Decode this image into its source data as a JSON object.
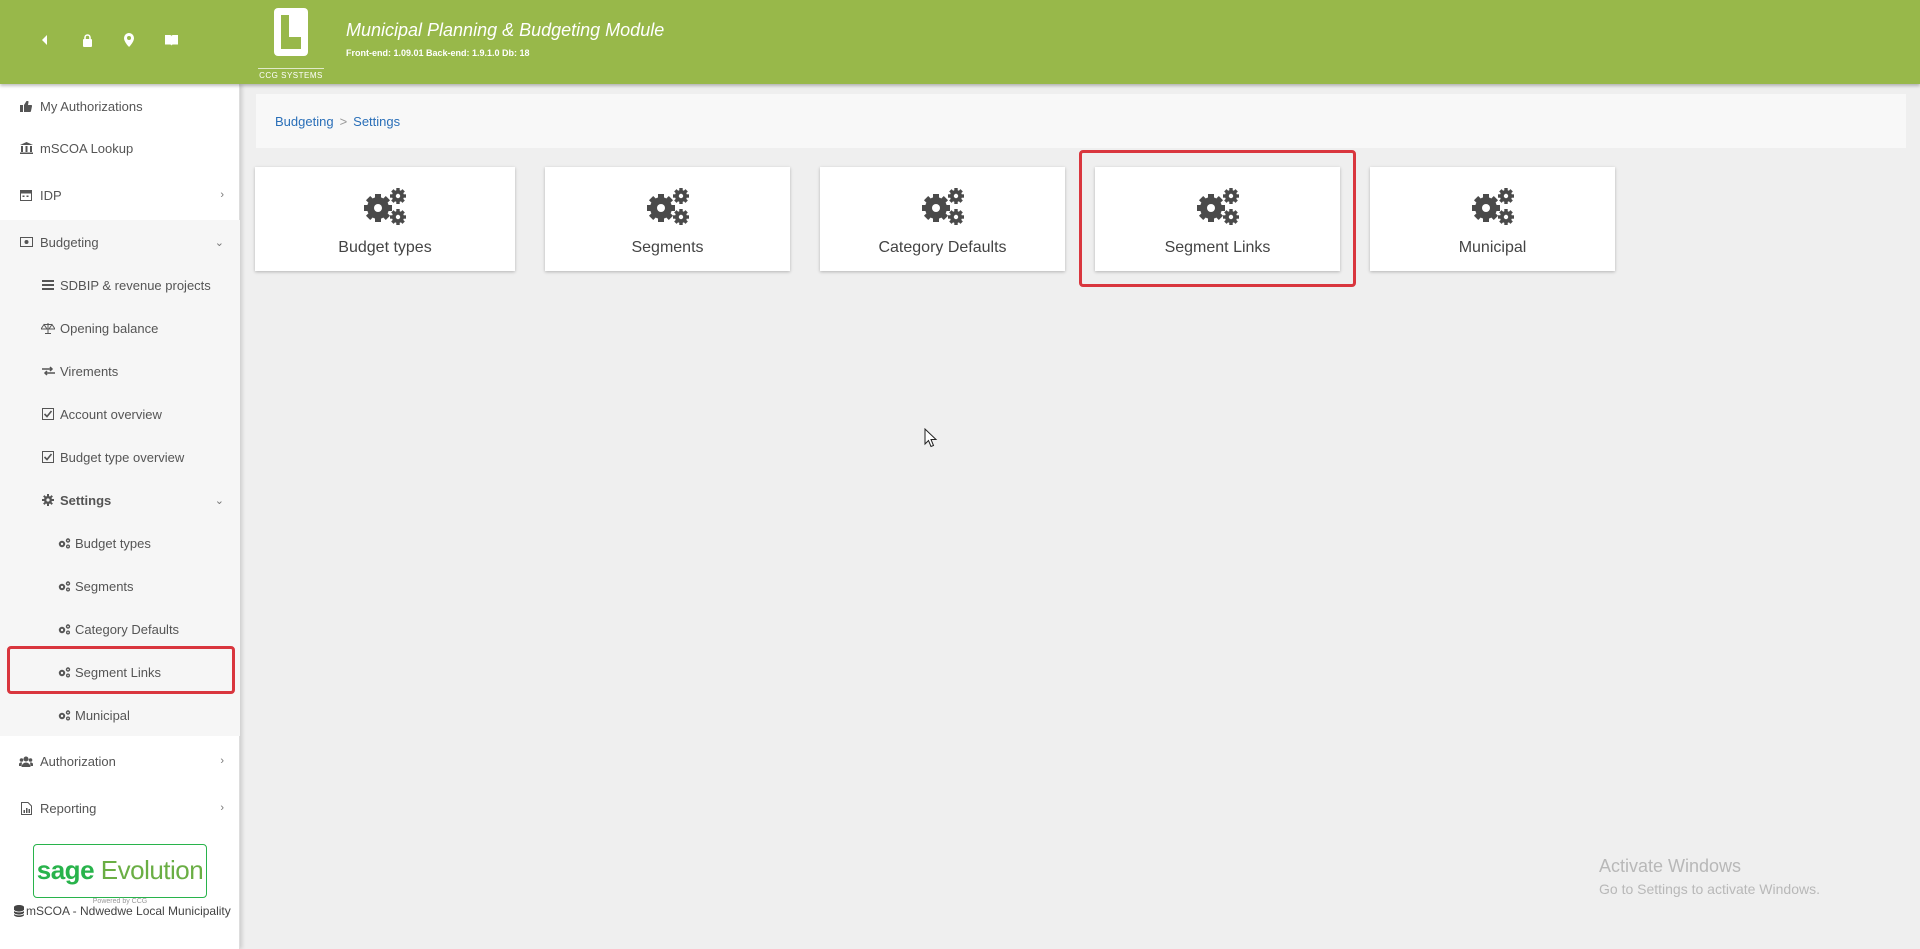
{
  "header": {
    "title": "Municipal Planning & Budgeting Module",
    "version": "Front-end: 1.09.01 Back-end: 1.9.1.0 Db: 18",
    "logo_caption": "CCG SYSTEMS",
    "icons": [
      "back-arrow-icon",
      "lock-icon",
      "map-marker-icon",
      "book-icon"
    ],
    "background_color": "#98b84a"
  },
  "sidebar": {
    "items": [
      {
        "label": "My Authorizations",
        "icon": "thumbs-up-icon"
      },
      {
        "label": "mSCOA Lookup",
        "icon": "bank-icon"
      },
      {
        "label": "IDP",
        "icon": "calendar-icon",
        "chevron": "›"
      },
      {
        "label": "Budgeting",
        "icon": "money-icon",
        "chevron": "⌄",
        "expanded": true
      },
      {
        "label": "Authorization",
        "icon": "users-icon",
        "chevron": "›"
      },
      {
        "label": "Reporting",
        "icon": "file-chart-icon",
        "chevron": "›"
      }
    ],
    "budgeting_children": [
      {
        "label": "SDBIP & revenue projects",
        "icon": "list-icon"
      },
      {
        "label": "Opening balance",
        "icon": "scale-icon"
      },
      {
        "label": "Virements",
        "icon": "exchange-icon"
      },
      {
        "label": "Account overview",
        "icon": "check-square-icon"
      },
      {
        "label": "Budget type overview",
        "icon": "check-square-icon"
      },
      {
        "label": "Settings",
        "icon": "cog-icon",
        "chevron": "⌄",
        "expanded": true
      }
    ],
    "settings_children": [
      {
        "label": "Budget types",
        "icon": "cogs-icon"
      },
      {
        "label": "Segments",
        "icon": "cogs-icon"
      },
      {
        "label": "Category Defaults",
        "icon": "cogs-icon"
      },
      {
        "label": "Segment Links",
        "icon": "cogs-icon",
        "highlighted": true
      },
      {
        "label": "Municipal",
        "icon": "cogs-icon"
      }
    ],
    "sage": {
      "brand": "sage",
      "product": "Evolution",
      "powered": "Powered by CCG"
    },
    "database": "mSCOA - Ndwedwe Local Municipality"
  },
  "breadcrumb": {
    "items": [
      "Budgeting",
      "Settings"
    ],
    "separator": ">"
  },
  "cards": [
    {
      "label": "Budget types",
      "icon": "cogs-icon"
    },
    {
      "label": "Segments",
      "icon": "cogs-icon"
    },
    {
      "label": "Category Defaults",
      "icon": "cogs-icon"
    },
    {
      "label": "Segment Links",
      "icon": "cogs-icon",
      "highlighted": true
    },
    {
      "label": "Municipal",
      "icon": "cogs-icon"
    }
  ],
  "watermark": {
    "title": "Activate Windows",
    "subtitle": "Go to Settings to activate Windows."
  },
  "colors": {
    "highlight": "#d9363e",
    "link": "#2a6fb8",
    "sage_green": "#28b34b"
  }
}
